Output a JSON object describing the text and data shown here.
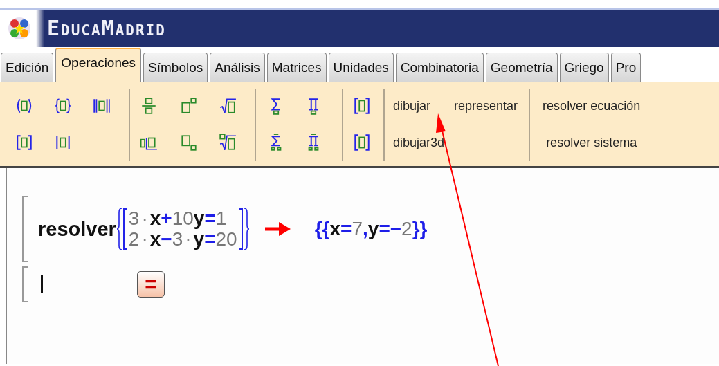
{
  "window": {
    "title": "EducaMadrid"
  },
  "tabs": [
    {
      "label": "Edición",
      "selected": false
    },
    {
      "label": "Operaciones",
      "selected": true
    },
    {
      "label": "Símbolos",
      "selected": false
    },
    {
      "label": "Análisis",
      "selected": false
    },
    {
      "label": "Matrices",
      "selected": false
    },
    {
      "label": "Unidades",
      "selected": false
    },
    {
      "label": "Combinatoria",
      "selected": false
    },
    {
      "label": "Geometría",
      "selected": false
    },
    {
      "label": "Griego",
      "selected": false
    },
    {
      "label": "Pro",
      "selected": false
    }
  ],
  "toolbar": {
    "command_groups": [
      {
        "rows": [
          [
            {
              "label": "dibujar"
            },
            {
              "label": "representar"
            }
          ],
          [
            {
              "label": "dibujar3d"
            }
          ]
        ]
      },
      {
        "rows": [
          [
            {
              "label": "resolver ecuación"
            }
          ],
          [
            {
              "label": "resolver sistema"
            }
          ]
        ]
      }
    ]
  },
  "worksheet": {
    "expression": {
      "command": "resolver",
      "equations": [
        [
          {
            "text": "3",
            "kind": "num"
          },
          {
            "text": "·",
            "kind": "dot"
          },
          {
            "text": "x",
            "kind": "var"
          },
          {
            "text": "+",
            "kind": "op"
          },
          {
            "text": "10",
            "kind": "num"
          },
          {
            "text": "y",
            "kind": "var"
          },
          {
            "text": "=",
            "kind": "op"
          },
          {
            "text": "1",
            "kind": "num"
          }
        ],
        [
          {
            "text": "2",
            "kind": "num"
          },
          {
            "text": "·",
            "kind": "dot"
          },
          {
            "text": "x",
            "kind": "var"
          },
          {
            "text": "−",
            "kind": "op"
          },
          {
            "text": "3",
            "kind": "num"
          },
          {
            "text": "·",
            "kind": "dot"
          },
          {
            "text": "y",
            "kind": "var"
          },
          {
            "text": "=",
            "kind": "op"
          },
          {
            "text": "20",
            "kind": "num"
          }
        ]
      ],
      "result": [
        {
          "text": "{{",
          "kind": "op"
        },
        {
          "text": "x",
          "kind": "var"
        },
        {
          "text": "=",
          "kind": "op"
        },
        {
          "text": "7",
          "kind": "num"
        },
        {
          "text": ",",
          "kind": "op"
        },
        {
          "text": "y",
          "kind": "var"
        },
        {
          "text": "=",
          "kind": "op"
        },
        {
          "text": "−",
          "kind": "op"
        },
        {
          "text": "2",
          "kind": "num"
        },
        {
          "text": "}}",
          "kind": "op"
        }
      ]
    },
    "input_button": {
      "label": "="
    }
  }
}
